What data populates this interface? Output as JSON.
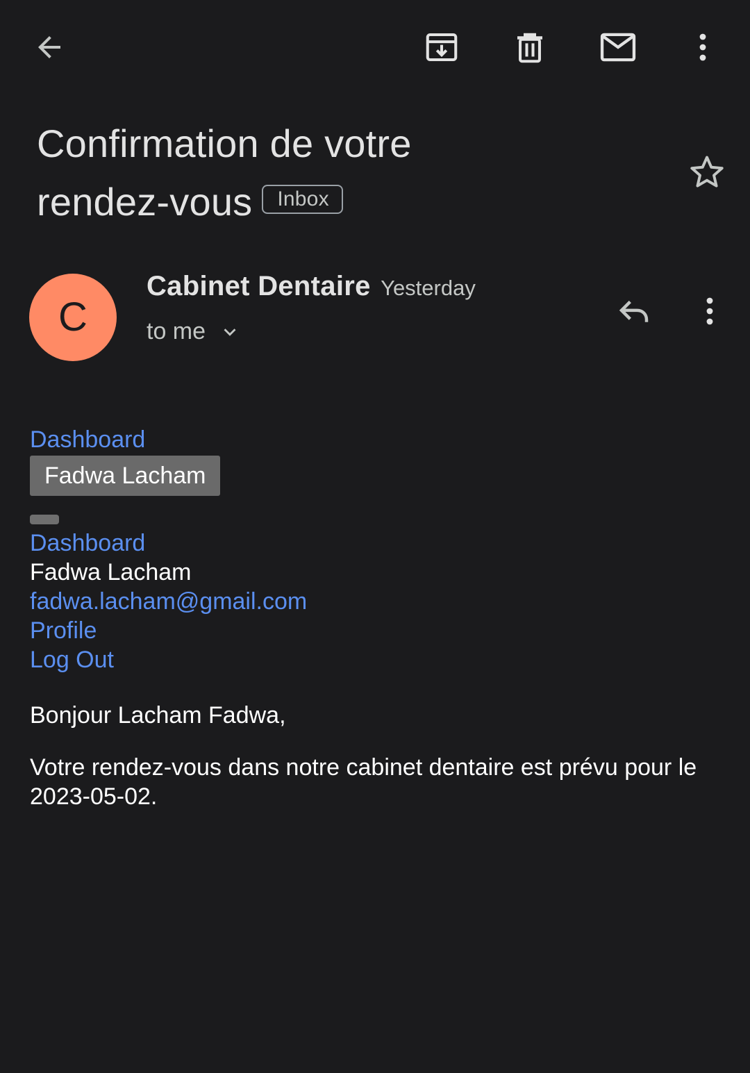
{
  "subject": {
    "line1": "Confirmation de votre",
    "line2": "rendez-vous",
    "label": "Inbox"
  },
  "icons": {
    "back": "back-arrow-icon",
    "archive": "archive-icon",
    "delete": "delete-icon",
    "mark_unread": "mail-icon",
    "more": "more-vert-icon",
    "star": "star-outline-icon",
    "reply": "reply-icon",
    "expand": "chevron-down-icon"
  },
  "message": {
    "avatar_letter": "C",
    "sender": "Cabinet Dentaire",
    "time": "Yesterday",
    "recipient": "to me"
  },
  "body": {
    "nav_link_1": "Dashboard",
    "name_chip": "Fadwa Lacham",
    "nav_link_2": "Dashboard",
    "user_name": "Fadwa Lacham",
    "email": "fadwa.lacham@gmail.com",
    "profile": "Profile",
    "logout": "Log Out",
    "greeting": "Bonjour Lacham Fadwa,",
    "paragraph": "Votre rendez-vous dans notre cabinet dentaire est prévu pour le 2023-05-02."
  },
  "colors": {
    "background": "#1b1b1d",
    "link": "#5b8ff0",
    "avatar": "#ff8a65"
  }
}
